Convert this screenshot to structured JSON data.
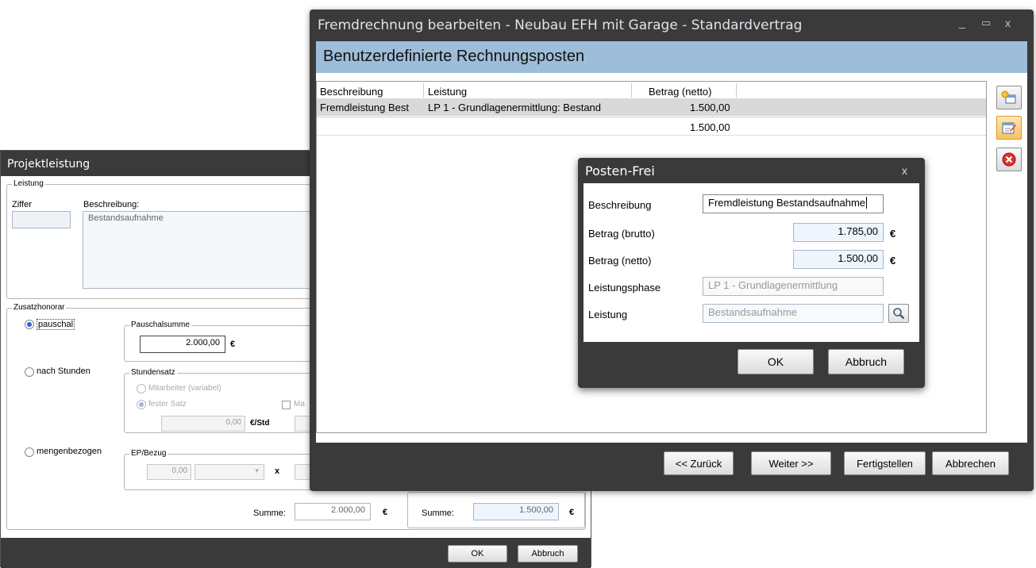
{
  "back_window": {
    "title": "Projektleistung",
    "leistung": {
      "legend": "Leistung",
      "ziffer_label": "Ziffer",
      "beschreibung_label": "Beschreibung:",
      "beschreibung_value": "Bestandsaufnahme"
    },
    "zusatzhonorar": {
      "legend": "Zusatzhonorar",
      "pauschal_label": "pauschal",
      "pauschalsumme_legend": "Pauschalsumme",
      "pauschalsumme_value": "2.000,00",
      "currency": "€",
      "nach_stunden_label": "nach Stunden",
      "stundensatz_legend": "Stundensatz",
      "mitarbeiter_label": "Mitarbeiter (variabel)",
      "fester_satz_label": "fester Satz",
      "ma_label": "Ma",
      "stundensatz_value": "0,00",
      "per_hour_unit": "€/Std",
      "mengenbezogen_label": "mengenbezogen",
      "ep_bezug_legend": "EP/Bezug",
      "ep_value": "0,00",
      "times_symbol": "x"
    },
    "summe_label": "Summe:",
    "summe_value": "2.000,00",
    "summe2_label": "Summe:",
    "summe2_value": "1.500,00",
    "ok_label": "OK",
    "cancel_label": "Abbruch"
  },
  "main_window": {
    "title": "Fremdrechnung bearbeiten - Neubau EFH mit Garage - Standardvertrag",
    "header": "Benutzerdefinierte Rechnungsposten",
    "columns": [
      "Beschreibung",
      "Leistung",
      "Betrag (netto)"
    ],
    "rows": [
      {
        "beschreibung": "Fremdleistung Best",
        "leistung": "LP  1 - Grundlagenermittlung: Bestand",
        "betrag": "1.500,00"
      }
    ],
    "total": "1.500,00",
    "buttons": {
      "back": "<< Zurück",
      "next": "Weiter >>",
      "finish": "Fertigstellen",
      "cancel": "Abbrechen"
    },
    "controls": {
      "minimize": "_",
      "maximize": "▭",
      "close": "x"
    }
  },
  "dialog": {
    "title": "Posten-Frei",
    "close": "x",
    "beschreibung_label": "Beschreibung",
    "beschreibung_value": "Fremdleistung Bestandsaufnahme",
    "brutto_label": "Betrag (brutto)",
    "brutto_value": "1.785,00",
    "netto_label": "Betrag (netto)",
    "netto_value": "1.500,00",
    "currency": "€",
    "phase_label": "Leistungsphase",
    "phase_value": "LP  1 - Grundlagenermittlung",
    "leistung_label": "Leistung",
    "leistung_value": "Bestandsaufnahme",
    "ok_label": "OK",
    "cancel_label": "Abbruch"
  },
  "colors": {
    "title_bar": "#3a3a3a",
    "header_blue": "#9dbdd9",
    "dialog_blue_field": "#eef5fd"
  }
}
